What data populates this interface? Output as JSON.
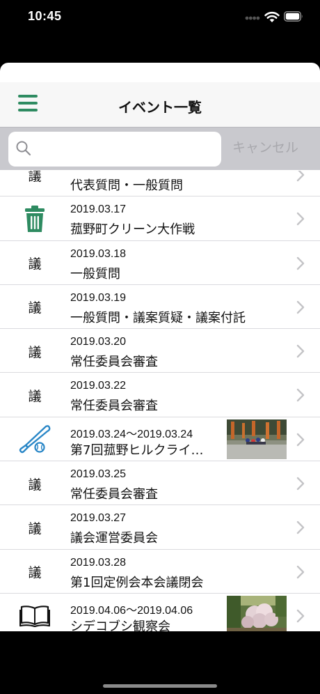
{
  "status_bar": {
    "time": "10:45"
  },
  "nav": {
    "title": "イベント一覧"
  },
  "search": {
    "placeholder": "",
    "value": "",
    "cancel_label": "キャンセル"
  },
  "accent_color": "#2e8b61",
  "events": [
    {
      "icon": "gikai",
      "icon_glyph": "議",
      "date": "",
      "title": "代表質問・一般質問",
      "has_thumbnail": false
    },
    {
      "icon": "trash-icon",
      "icon_glyph": "",
      "date": "2019.03.17",
      "title": "菰野町クリーン大作戦",
      "has_thumbnail": false
    },
    {
      "icon": "gikai",
      "icon_glyph": "議",
      "date": "2019.03.18",
      "title": "一般質問",
      "has_thumbnail": false
    },
    {
      "icon": "gikai",
      "icon_glyph": "議",
      "date": "2019.03.19",
      "title": "一般質問・議案質疑・議案付託",
      "has_thumbnail": false
    },
    {
      "icon": "gikai",
      "icon_glyph": "議",
      "date": "2019.03.20",
      "title": "常任委員会審査",
      "has_thumbnail": false
    },
    {
      "icon": "gikai",
      "icon_glyph": "議",
      "date": "2019.03.22",
      "title": "常任委員会審査",
      "has_thumbnail": false
    },
    {
      "icon": "baseball-icon",
      "icon_glyph": "",
      "date": "2019.03.24～2019.03.24",
      "title": "第7回菰野ヒルクライ…",
      "has_thumbnail": true
    },
    {
      "icon": "gikai",
      "icon_glyph": "議",
      "date": "2019.03.25",
      "title": "常任委員会審査",
      "has_thumbnail": false
    },
    {
      "icon": "gikai",
      "icon_glyph": "議",
      "date": "2019.03.27",
      "title": "議会運営委員会",
      "has_thumbnail": false
    },
    {
      "icon": "gikai",
      "icon_glyph": "議",
      "date": "2019.03.28",
      "title": "第1回定例会本会議閉会",
      "has_thumbnail": false
    },
    {
      "icon": "book-icon",
      "icon_glyph": "",
      "date": "2019.04.06～2019.04.06",
      "title": "シデコブシ観察会",
      "has_thumbnail": true
    }
  ]
}
